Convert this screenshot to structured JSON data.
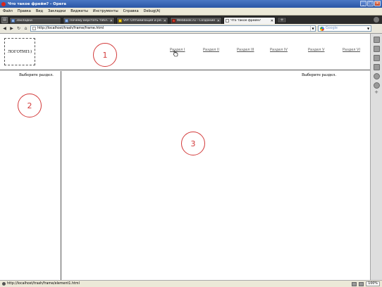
{
  "window": {
    "title": "Что такое фрейм? - Opera"
  },
  "menu": [
    "Файл",
    "Правка",
    "Вид",
    "Закладки",
    "Виджеты",
    "Инструменты",
    "Справка",
    "Debug(A)"
  ],
  "tabs": [
    {
      "label": "Закладки",
      "icon": "bookmark-icon",
      "active": false,
      "closable": false
    },
    {
      "label": "Почему верстать табл...",
      "icon": "page-icon",
      "active": false,
      "closable": true
    },
    {
      "label": "VIP: Оптимизация и ре...",
      "icon": "page-icon",
      "active": false,
      "closable": true
    },
    {
      "label": "Webbook.ru - Создание ...",
      "icon": "page-icon",
      "active": false,
      "closable": true
    },
    {
      "label": "Что такое фрейм?",
      "icon": "page-icon",
      "active": true,
      "closable": true
    }
  ],
  "tab_close_glyph": "✕",
  "new_tab_glyph": "+",
  "address": {
    "url": "http://localhost/trash/frame/frame.html",
    "search_placeholder": "Google"
  },
  "page": {
    "logo": "ЛОГОТИП:)",
    "nav_links": [
      "Раздел I",
      "Раздел II",
      "Раздел III",
      "Раздел IV",
      "Раздел V",
      "Раздел VI"
    ],
    "left_prompt": "Выберите раздел.",
    "main_prompt": "Выберите раздел.",
    "markers": [
      "1",
      "2",
      "3"
    ]
  },
  "status": {
    "text": "http://localhost/trash/frame/element1.html",
    "zoom": "100%"
  },
  "colors": {
    "marker": "#d33a3a",
    "titlebar": "#2a55a5",
    "tabbar": "#2c2c2c"
  }
}
